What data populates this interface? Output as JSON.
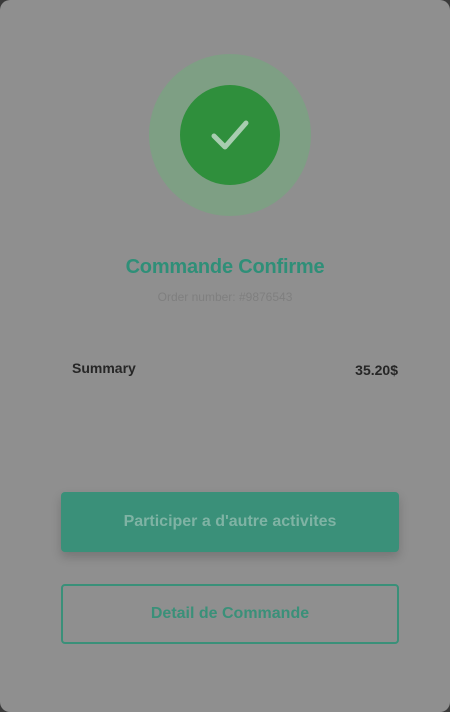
{
  "confirmation": {
    "status_icon": "check-icon",
    "title": "Commande Confirme",
    "order_number": "Order number: #9876543"
  },
  "summary": {
    "label": "Summary",
    "total": "35.20$"
  },
  "actions": {
    "primary_label": "Participer a d'autre activites",
    "secondary_label": "Detail de Commande"
  },
  "colors": {
    "accent": "#3a9079",
    "success": "#2f8f3c",
    "overlay": "#8f8f8f"
  }
}
